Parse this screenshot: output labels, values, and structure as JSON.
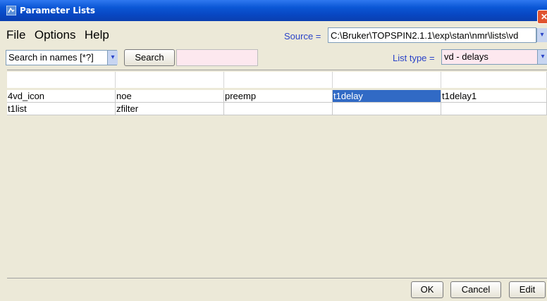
{
  "window": {
    "title": "Parameter Lists",
    "close_glyph": "✕"
  },
  "menu": [
    "File",
    "Options",
    "Help"
  ],
  "source": {
    "label": "Source =",
    "value": "C:\\Bruker\\TOPSPIN2.1.1\\exp\\stan\\nmr\\lists\\vd"
  },
  "search": {
    "combo_value": "Search in names [*?]",
    "button_label": "Search",
    "input_value": ""
  },
  "list_type": {
    "label": "List type =",
    "value": "vd - delays"
  },
  "table": {
    "rows": [
      [
        "4vd_icon",
        "noe",
        "preemp",
        "t1delay",
        "t1delay1"
      ],
      [
        "t1list",
        "zfilter",
        "",
        "",
        ""
      ]
    ],
    "selected": {
      "row": 0,
      "col": 3
    }
  },
  "buttons": {
    "ok": "OK",
    "cancel": "Cancel",
    "edit": "Edit"
  },
  "colors": {
    "selection": "#316ac5",
    "label_blue": "#2a43c8",
    "titlebar": "#0b57d6"
  },
  "icons": {
    "app": "bruker-app-icon",
    "dropdown": "chevron-down-icon"
  }
}
